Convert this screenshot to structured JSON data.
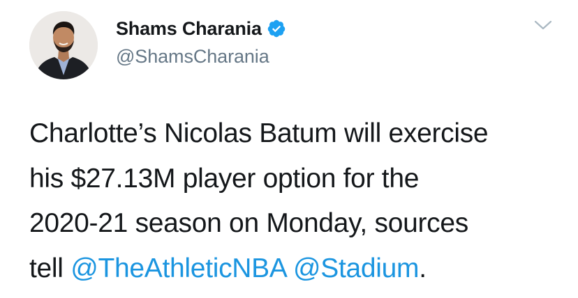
{
  "author": {
    "display_name": "Shams Charania",
    "handle": "@ShamsCharania",
    "verified": true,
    "avatar_icon": "profile-photo"
  },
  "tweet": {
    "text_lines": [
      "Charlotte’s Nicolas Batum will exercise",
      "his $27.13M player option for the",
      "2020-21 season on Monday, sources"
    ],
    "last_line_prefix": "tell ",
    "mention_1": "@TheAthleticNBA",
    "mention_separator": " ",
    "mention_2": "@Stadium",
    "last_line_suffix": "."
  },
  "icons": {
    "verified": "verified-badge-icon",
    "menu": "chevron-down-icon"
  },
  "colors": {
    "text": "#14171a",
    "secondary": "#657786",
    "link": "#1b95e0",
    "verified": "#1da1f2",
    "chevron": "#aab8c2"
  }
}
